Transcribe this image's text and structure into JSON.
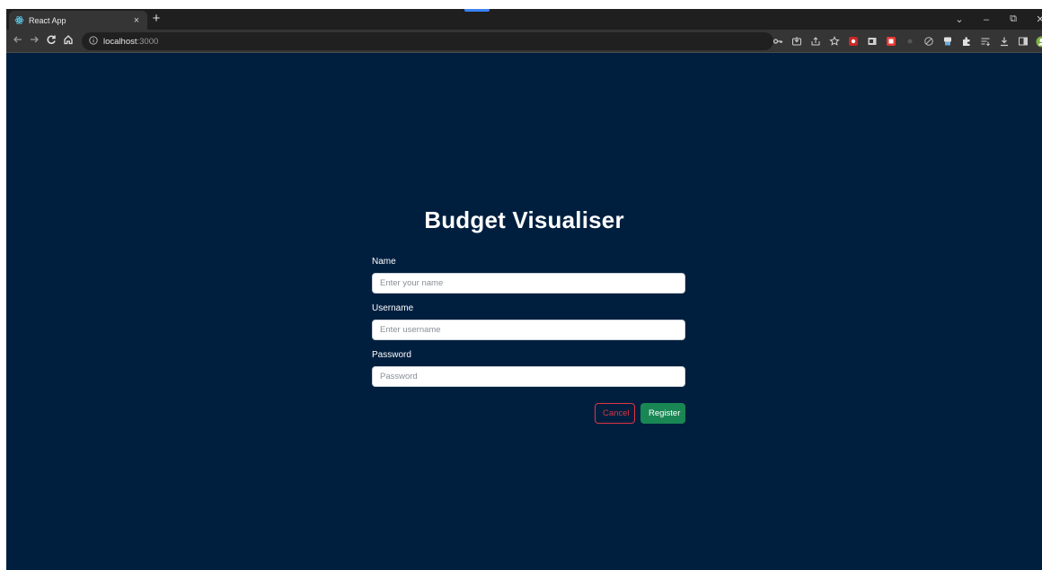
{
  "browser": {
    "tab": {
      "title": "React App",
      "close": "×"
    },
    "new_tab": "+",
    "address": {
      "host": "localhost",
      "port": ":3000"
    },
    "window_controls": {
      "dropdown": "⌄",
      "minimize": "–",
      "restore": "⧉",
      "close": "✕"
    }
  },
  "page": {
    "title": "Budget Visualiser",
    "fields": {
      "name": {
        "label": "Name",
        "placeholder": "Enter your name"
      },
      "username": {
        "label": "Username",
        "placeholder": "Enter username"
      },
      "password": {
        "label": "Password",
        "placeholder": "Password"
      }
    },
    "buttons": {
      "cancel": "Cancel",
      "register": "Register"
    }
  },
  "colors": {
    "page_background": "#001f3f",
    "cancel_button": "#dc3545",
    "register_button": "#198754"
  },
  "icons": [
    "react-favicon",
    "back-icon",
    "forward-icon",
    "reload-icon",
    "home-icon",
    "info-icon",
    "key-icon",
    "install-icon",
    "share-icon",
    "bookmark-star-icon",
    "extension-icons",
    "extensions-puzzle-icon",
    "reading-list-icon",
    "download-icon",
    "side-panel-icon",
    "profile-avatar-icon",
    "menu-icon"
  ]
}
